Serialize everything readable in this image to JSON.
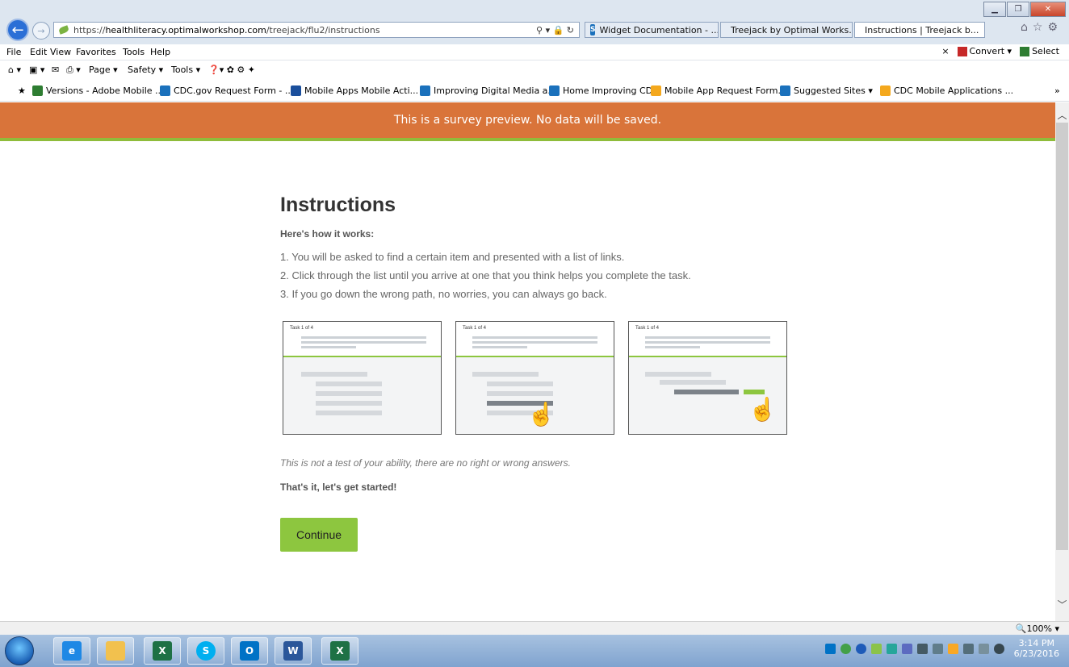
{
  "browser": {
    "address_scheme": "https://",
    "address_domain": "healthliteracy.optimalworkshop.com",
    "address_path": "/treejack/flu2/instructions",
    "address_icons": "⚲ ▾ 🔒 ↻",
    "tabs": [
      {
        "label": "Widget Documentation - ..."
      },
      {
        "label": "Treejack by Optimal Works..."
      },
      {
        "label": "Instructions | Treejack b..."
      }
    ],
    "tab_close": "×",
    "menu": [
      "File",
      "Edit",
      "View",
      "Favorites",
      "Tools",
      "Help"
    ],
    "menu_right": {
      "close": "×",
      "convert": "Convert",
      "select": "Select"
    },
    "commands": {
      "page": "Page ▾",
      "safety": "Safety ▾",
      "tools": "Tools ▾"
    },
    "favorites": [
      {
        "label": "Versions - Adobe Mobile ...",
        "color": "#2e7d32"
      },
      {
        "label": "CDC.gov Request Form - ...",
        "color": "#1b71bc"
      },
      {
        "label": "Mobile Apps Mobile Acti...",
        "color": "#1b4f9c"
      },
      {
        "label": "Improving Digital Media a...",
        "color": "#1b71bc"
      },
      {
        "label": "Home Improving CDC",
        "color": "#1b71bc"
      },
      {
        "label": "Mobile App Request Form...",
        "color": "#f4a81d"
      },
      {
        "label": "Suggested Sites ▾",
        "color": "#1b71bc"
      },
      {
        "label": "CDC Mobile Applications ...",
        "color": "#f4a81d"
      }
    ],
    "zoom": "🔍100%  ▾"
  },
  "banner": "This is a survey preview. No data will be saved.",
  "main": {
    "title": "Instructions",
    "intro": "Here's how it works:",
    "steps": [
      "1. You will be asked to find a certain item and presented with a list of links.",
      "2. Click through the list until you arrive at one that you think helps you complete the task.",
      "3. If you go down the wrong path, no worries, you can always go back."
    ],
    "card_label": "Task 1 of 4",
    "note": "This is not a test of your ability, there are no right or wrong answers.",
    "start": "That's it, let's get started!",
    "continue_label": "Continue"
  },
  "taskbar": {
    "apps": [
      {
        "icon": "ie-icon",
        "glyph": "e",
        "color": "#1e88e5"
      },
      {
        "icon": "folder-icon",
        "glyph": "",
        "color": "#f2c14e"
      },
      {
        "icon": "excel-icon",
        "glyph": "X",
        "color": "#1e7145"
      },
      {
        "icon": "skype-icon",
        "glyph": "S",
        "color": "#00aff0"
      },
      {
        "icon": "outlook-icon",
        "glyph": "O",
        "color": "#0072c6"
      },
      {
        "icon": "word-icon",
        "glyph": "W",
        "color": "#2b579a"
      },
      {
        "icon": "excel-icon",
        "glyph": "X",
        "color": "#1e7145"
      }
    ],
    "time": "3:14 PM",
    "date": "6/23/2016"
  }
}
